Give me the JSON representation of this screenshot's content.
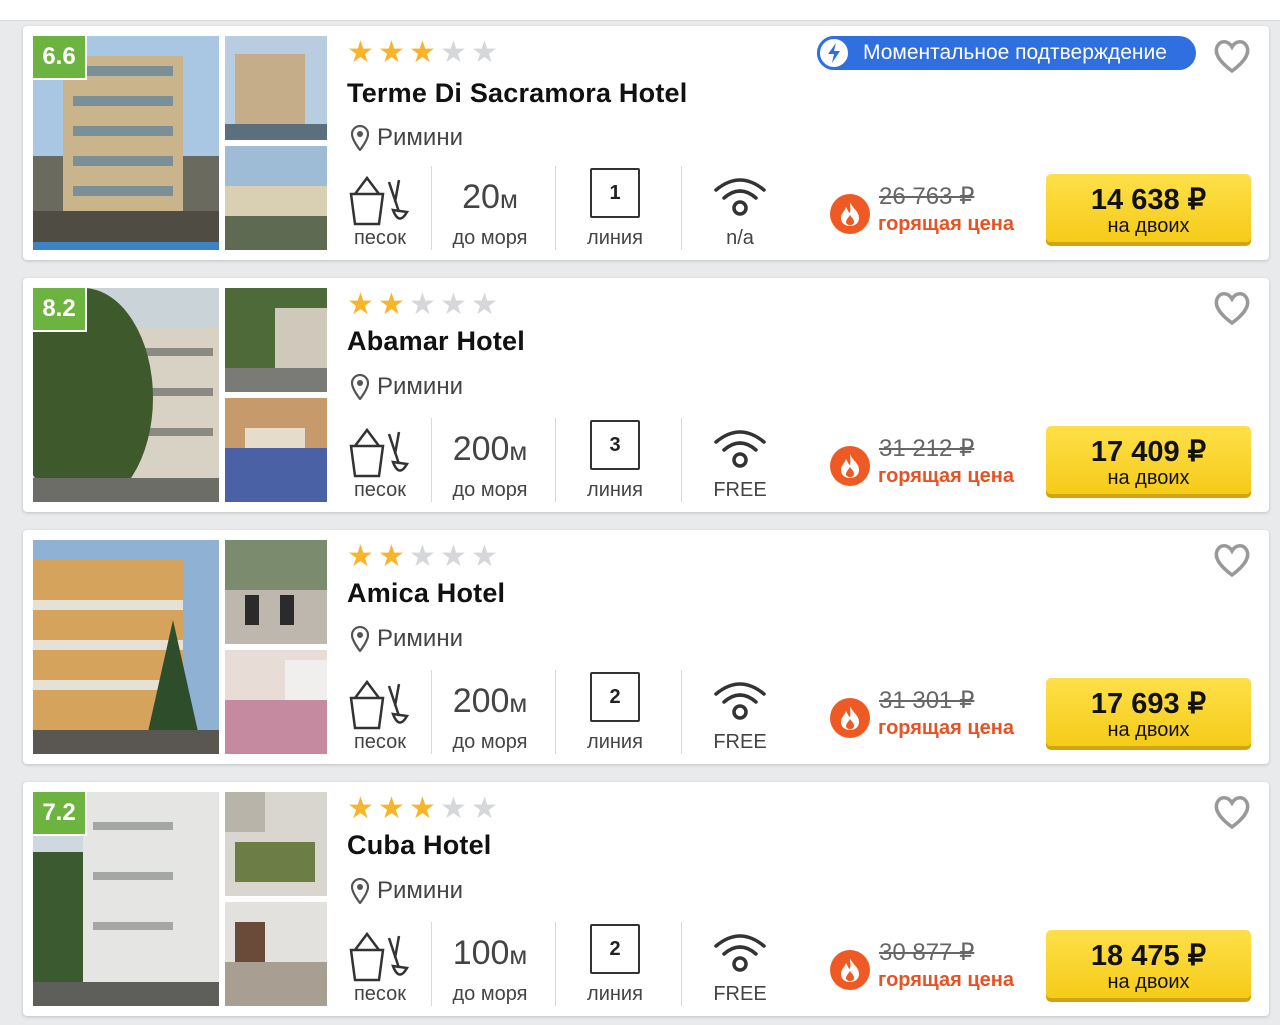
{
  "hotels": [
    {
      "rating": "6.6",
      "stars": 3,
      "name": "Terme Di Sacramora Hotel",
      "city": "Римини",
      "beach_label": "песок",
      "distance_value": "20",
      "distance_unit": "м",
      "distance_label": "до моря",
      "line_number": "1",
      "line_label": "линия",
      "wifi_label": "n/a",
      "instant_badge": "Моментальное подтверждение",
      "old_price": "26 763 ₽",
      "hot_label": "горящая цена",
      "price": "14 638 ₽",
      "price_note": "на двоих"
    },
    {
      "rating": "8.2",
      "stars": 2,
      "name": "Abamar Hotel",
      "city": "Римини",
      "beach_label": "песок",
      "distance_value": "200",
      "distance_unit": "м",
      "distance_label": "до моря",
      "line_number": "3",
      "line_label": "линия",
      "wifi_label": "FREE",
      "instant_badge": "",
      "old_price": "31 212 ₽",
      "hot_label": "горящая цена",
      "price": "17 409 ₽",
      "price_note": "на двоих"
    },
    {
      "rating": "",
      "stars": 2,
      "name": "Amica Hotel",
      "city": "Римини",
      "beach_label": "песок",
      "distance_value": "200",
      "distance_unit": "м",
      "distance_label": "до моря",
      "line_number": "2",
      "line_label": "линия",
      "wifi_label": "FREE",
      "instant_badge": "",
      "old_price": "31 301 ₽",
      "hot_label": "горящая цена",
      "price": "17 693 ₽",
      "price_note": "на двоих"
    },
    {
      "rating": "7.2",
      "stars": 3,
      "name": "Cuba Hotel",
      "city": "Римини",
      "beach_label": "песок",
      "distance_value": "100",
      "distance_unit": "м",
      "distance_label": "до моря",
      "line_number": "2",
      "line_label": "линия",
      "wifi_label": "FREE",
      "instant_badge": "",
      "old_price": "30 877 ₽",
      "hot_label": "горящая цена",
      "price": "18 475 ₽",
      "price_note": "на двоих"
    }
  ],
  "colors": {
    "accent_blue": "#2f6fdf",
    "star_on": "#f7b52c",
    "star_off": "#d6d7da",
    "rating_green": "#6cb33f",
    "hot_orange": "#ef5a24",
    "price_yellow": "#fad630"
  },
  "icons": [
    "map-pin-icon",
    "beach-bucket-icon",
    "wifi-icon",
    "fire-icon",
    "lightning-icon",
    "heart-icon",
    "star-icon"
  ]
}
